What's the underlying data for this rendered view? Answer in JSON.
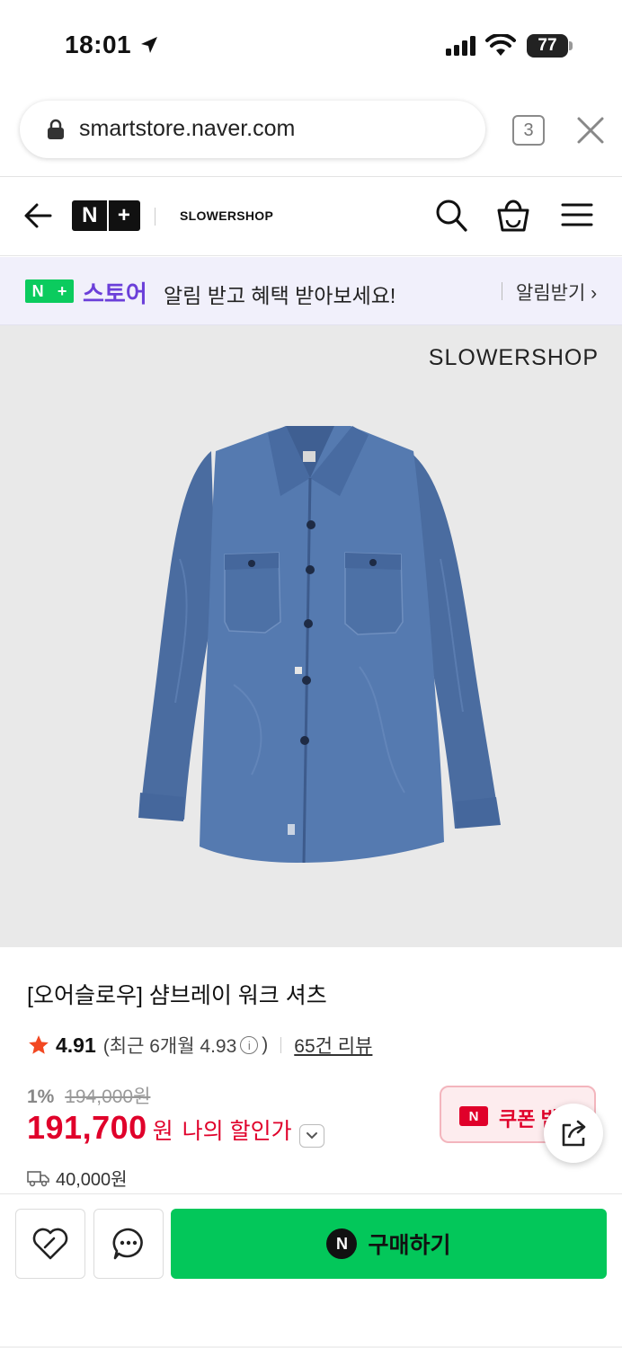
{
  "status_bar": {
    "time": "18:01",
    "battery": "77",
    "icons": [
      "location-arrow-icon",
      "signal-icon",
      "wifi-icon",
      "battery-icon"
    ]
  },
  "browser": {
    "url": "smartstore.naver.com",
    "tab_count": "3",
    "icons": [
      "lock-icon",
      "close-icon"
    ]
  },
  "header": {
    "logo_left": "N",
    "logo_right": "+",
    "shop_name": "SLOWERSHOP",
    "icons": [
      "back-arrow-icon",
      "search-icon",
      "cart-icon",
      "menu-icon"
    ]
  },
  "banner": {
    "badge_left": "N",
    "badge_right": "+",
    "store_label": "스토어",
    "message": "알림 받고 혜택 받아보세요!",
    "action_label": "알림받기",
    "accent": "#6b3fd9",
    "green": "#0bcb5e"
  },
  "hero": {
    "brand_watermark": "SLOWERSHOP",
    "background": "#e9e9e9"
  },
  "product": {
    "title": "[오어슬로우] 샴브레이 워크 셔츠",
    "rating": "4.91",
    "recent_label": "(최근 6개월 4.93",
    "recent_close": ")",
    "info_glyph": "i",
    "review_count": "65건 리뷰",
    "discount_rate": "1%",
    "original_price": "194,000원",
    "price": "191,700",
    "currency": "원",
    "my_discount_label": "나의 할인가",
    "shipping": "40,000원",
    "price_color": "#e0002a"
  },
  "coupon": {
    "badge": "N",
    "label": "쿠폰 받기"
  },
  "actions": {
    "buy_badge": "N",
    "buy_label": "구매하기",
    "buy_color": "#03c75a",
    "icons": [
      "heart-icon",
      "chat-icon",
      "share-icon"
    ]
  }
}
